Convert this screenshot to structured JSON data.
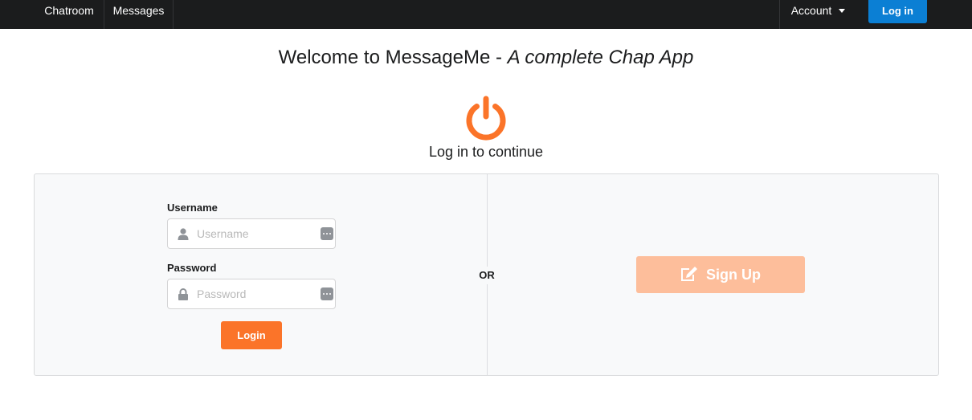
{
  "navbar": {
    "items": [
      {
        "label": "Chatroom"
      },
      {
        "label": "Messages"
      }
    ],
    "account_label": "Account",
    "login_label": "Log in"
  },
  "header": {
    "title_main": "Welcome to MessageMe - ",
    "title_tagline": "A complete Chap App",
    "subtitle": "Log in to continue",
    "icon": "power-icon"
  },
  "form": {
    "username_label": "Username",
    "username_placeholder": "Username",
    "username_value": "",
    "password_label": "Password",
    "password_placeholder": "Password",
    "password_value": "",
    "login_button": "Login"
  },
  "divider_label": "OR",
  "signup": {
    "label": "Sign Up",
    "icon": "edit-icon"
  },
  "colors": {
    "navbar_bg": "#1b1c1d",
    "nav_login_bg": "#0b7fd4",
    "accent_orange": "#fb7429",
    "signup_disabled_bg": "#fdbe9b",
    "segment_bg": "#f8f9fa"
  }
}
